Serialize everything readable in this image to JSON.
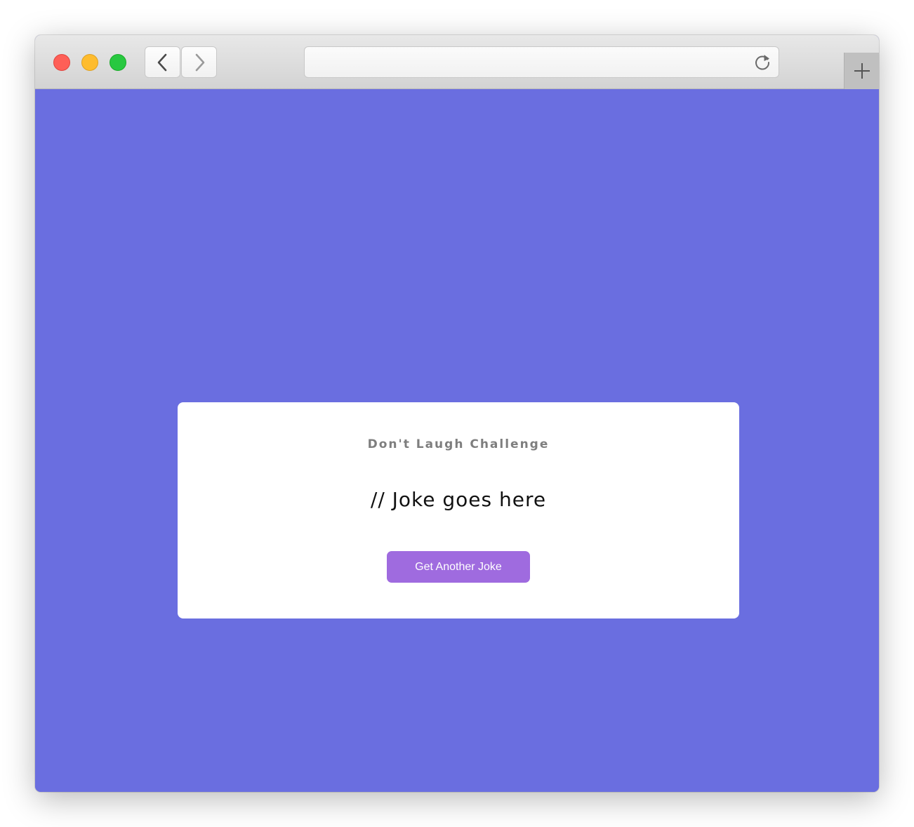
{
  "browser": {
    "address": "",
    "icons": {
      "back": "chevron-left-icon",
      "forward": "chevron-right-icon",
      "reload": "reload-icon",
      "new_tab": "plus-icon"
    },
    "colors": {
      "close": "#fe5f57",
      "minimize": "#febc2e",
      "maximize": "#28c840"
    }
  },
  "page": {
    "background": "#6a6ee0",
    "card": {
      "heading": "Don't Laugh Challenge",
      "joke": "// Joke goes here",
      "button_label": "Get Another Joke",
      "button_color": "#9f6bdf"
    }
  }
}
